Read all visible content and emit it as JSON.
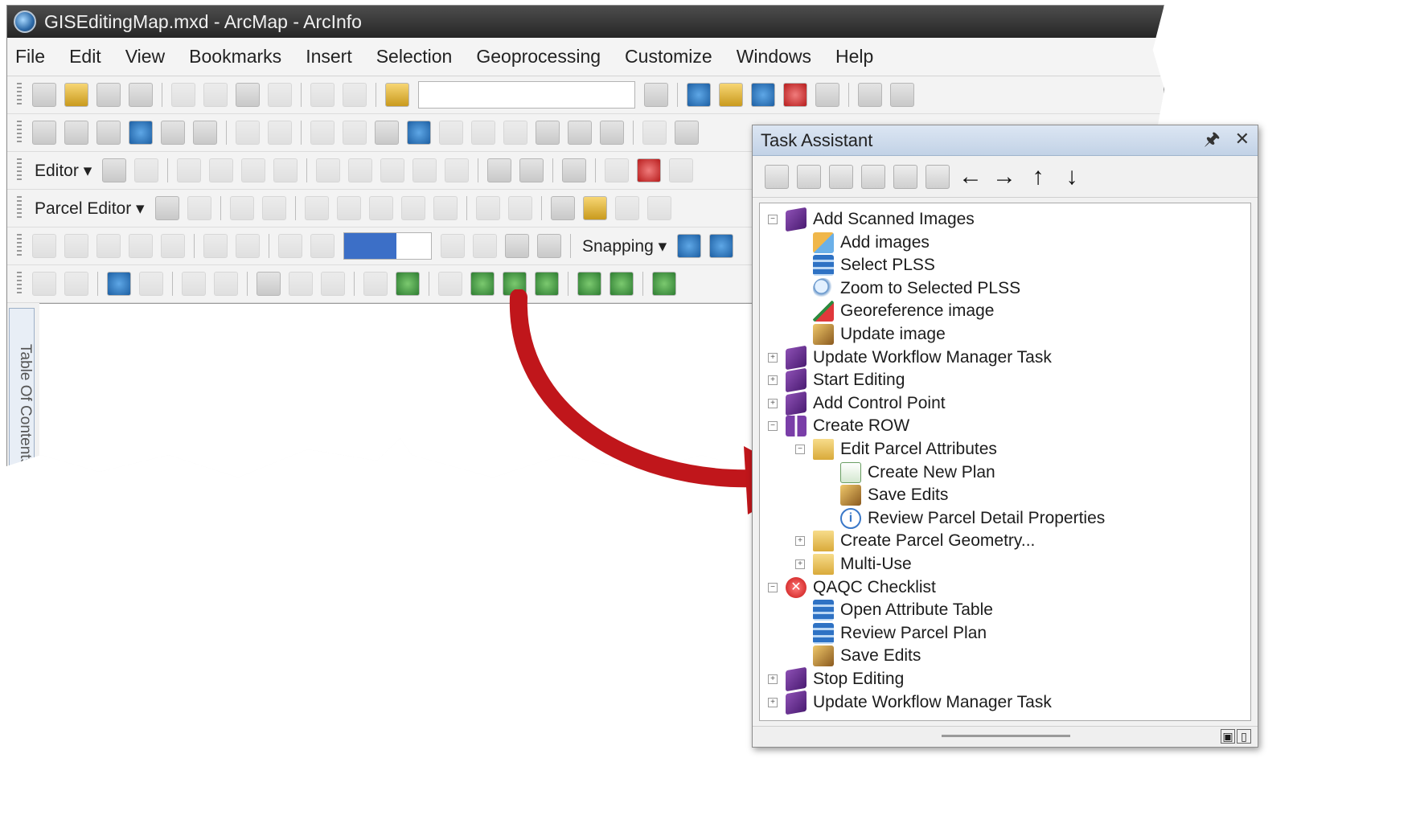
{
  "window": {
    "title": "GISEditingMap.mxd - ArcMap - ArcInfo"
  },
  "menu": [
    "File",
    "Edit",
    "View",
    "Bookmarks",
    "Insert",
    "Selection",
    "Geoprocessing",
    "Customize",
    "Windows",
    "Help"
  ],
  "toolbars": {
    "editor_label": "Editor ▾",
    "parcel_editor_label": "Parcel Editor ▾",
    "snapping_label": "Snapping ▾"
  },
  "toc_tab": "Table Of Contents",
  "task_assistant": {
    "title": "Task Assistant",
    "pin_icon": "pin-icon",
    "close_icon": "close-icon",
    "toolbar_arrows": [
      "←",
      "→",
      "↑",
      "↓"
    ],
    "tree": [
      {
        "label": "Add Scanned Images",
        "icon": "book-icon",
        "level": 0,
        "expander": "−"
      },
      {
        "label": "Add images",
        "icon": "add-images-icon",
        "level": 1,
        "expander": ""
      },
      {
        "label": "Select PLSS",
        "icon": "select-table-icon",
        "level": 1,
        "expander": ""
      },
      {
        "label": "Zoom to Selected PLSS",
        "icon": "zoom-icon",
        "level": 1,
        "expander": ""
      },
      {
        "label": "Georeference image",
        "icon": "georeference-icon",
        "level": 1,
        "expander": ""
      },
      {
        "label": "Update image",
        "icon": "update-icon",
        "level": 1,
        "expander": ""
      },
      {
        "label": "Update Workflow Manager Task",
        "icon": "book-icon",
        "level": 0,
        "expander": "+"
      },
      {
        "label": "Start Editing",
        "icon": "book-icon",
        "level": 0,
        "expander": "+"
      },
      {
        "label": "Add Control Point",
        "icon": "book-icon",
        "level": 0,
        "expander": "+"
      },
      {
        "label": "Create ROW",
        "icon": "open-book-icon",
        "level": 0,
        "expander": "−"
      },
      {
        "label": "Edit Parcel Attributes",
        "icon": "folder-open-icon",
        "level": 1,
        "expander": "−"
      },
      {
        "label": "Create New Plan",
        "icon": "new-plan-icon",
        "level": 2,
        "expander": ""
      },
      {
        "label": "Save Edits",
        "icon": "save-edits-icon",
        "level": 2,
        "expander": ""
      },
      {
        "label": "Review Parcel Detail Properties",
        "icon": "info-icon",
        "level": 2,
        "expander": ""
      },
      {
        "label": "Create Parcel Geometry...",
        "icon": "folder-icon",
        "level": 1,
        "expander": "+"
      },
      {
        "label": "Multi-Use",
        "icon": "folder-icon",
        "level": 1,
        "expander": "+"
      },
      {
        "label": "QAQC Checklist",
        "icon": "error-icon",
        "level": 0,
        "expander": "−"
      },
      {
        "label": "Open Attribute Table",
        "icon": "table-icon",
        "level": 1,
        "expander": ""
      },
      {
        "label": "Review Parcel Plan",
        "icon": "table-icon",
        "level": 1,
        "expander": ""
      },
      {
        "label": "Save Edits",
        "icon": "save-edits-icon",
        "level": 1,
        "expander": ""
      },
      {
        "label": "Stop Editing",
        "icon": "book-icon",
        "level": 0,
        "expander": "+"
      },
      {
        "label": "Update Workflow Manager Task",
        "icon": "book-icon",
        "level": 0,
        "expander": "+"
      }
    ]
  },
  "colors": {
    "arrow": "#c0161b",
    "title_bar": "#333333",
    "panel_title": "#c9d7ea"
  }
}
